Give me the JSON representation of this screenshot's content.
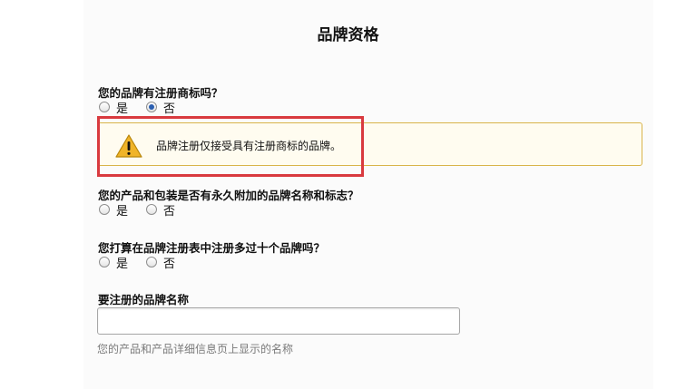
{
  "page": {
    "title": "品牌资格"
  },
  "q1": {
    "question": "您的品牌有注册商标吗？",
    "options": [
      {
        "label": "是",
        "checked": false
      },
      {
        "label": "否",
        "checked": true
      }
    ]
  },
  "alert": {
    "message": "品牌注册仅接受具有注册商标的品牌。",
    "icon": "warning-icon"
  },
  "q2": {
    "question": "您的产品和包装是否有永久附加的品牌名称和标志？",
    "options": [
      {
        "label": "是",
        "checked": false
      },
      {
        "label": "否",
        "checked": false
      }
    ]
  },
  "q3": {
    "question": "您打算在品牌注册表中注册多过十个品牌吗？",
    "options": [
      {
        "label": "是",
        "checked": false
      },
      {
        "label": "否",
        "checked": false
      }
    ]
  },
  "brand_name": {
    "label": "要注册的品牌名称",
    "value": "",
    "helper": "您的产品和产品详细信息页上显示的名称"
  },
  "colors": {
    "alert_border": "#d9b44a",
    "alert_background": "#fffcf0",
    "highlight": "#d93a3f",
    "radio_selected": "#2b5fb0"
  }
}
